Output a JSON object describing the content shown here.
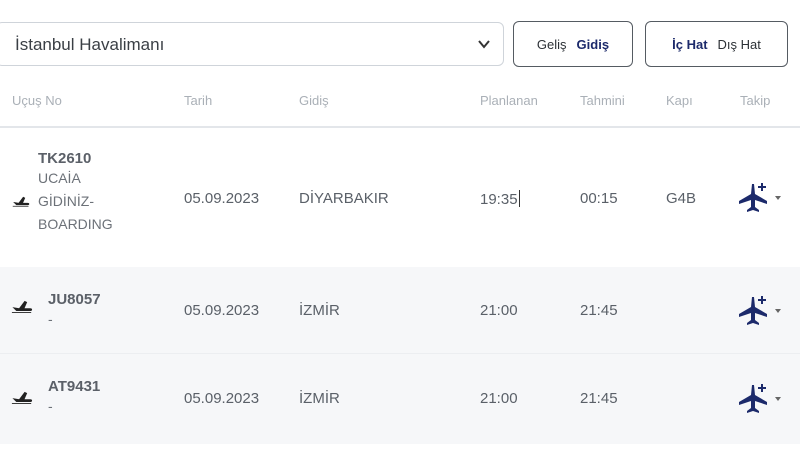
{
  "filters": {
    "airport": "İstanbul Havalimanı",
    "direction": {
      "arrival_label": "Geliş",
      "departure_label": "Gidiş"
    },
    "line": {
      "domestic_label": "İç Hat",
      "international_label": "Dış Hat"
    }
  },
  "table": {
    "headers": {
      "flight_no": "Uçuş No",
      "date": "Tarih",
      "destination": "Gidiş",
      "planned": "Planlanan",
      "estimated": "Tahmini",
      "gate": "Kapı",
      "follow": "Takip"
    },
    "rows": [
      {
        "flight_no": "TK2610",
        "status_line1": "UCAİA",
        "status_line2": "GİDİNİZ-",
        "status_line3": "BOARDING",
        "date": "05.09.2023",
        "destination": "DİYARBAKIR",
        "planned": "19:35",
        "estimated": "00:15",
        "gate": "G4B"
      },
      {
        "flight_no": "JU8057",
        "status_line1": "-",
        "date": "05.09.2023",
        "destination": "İZMİR",
        "planned": "21:00",
        "estimated": "21:45",
        "gate": ""
      },
      {
        "flight_no": "AT9431",
        "status_line1": "-",
        "date": "05.09.2023",
        "destination": "İZMİR",
        "planned": "21:00",
        "estimated": "21:45",
        "gate": ""
      }
    ]
  },
  "icons": {
    "row_icon": "departure-plane-icon",
    "track_icon": "plane-plus-icon",
    "dropdown_icon": "chevron-down-icon"
  },
  "colors": {
    "accent_text": "#1c2a6b",
    "header_text": "#aab0b7",
    "row_alt_bg": "#f6f7f9"
  }
}
